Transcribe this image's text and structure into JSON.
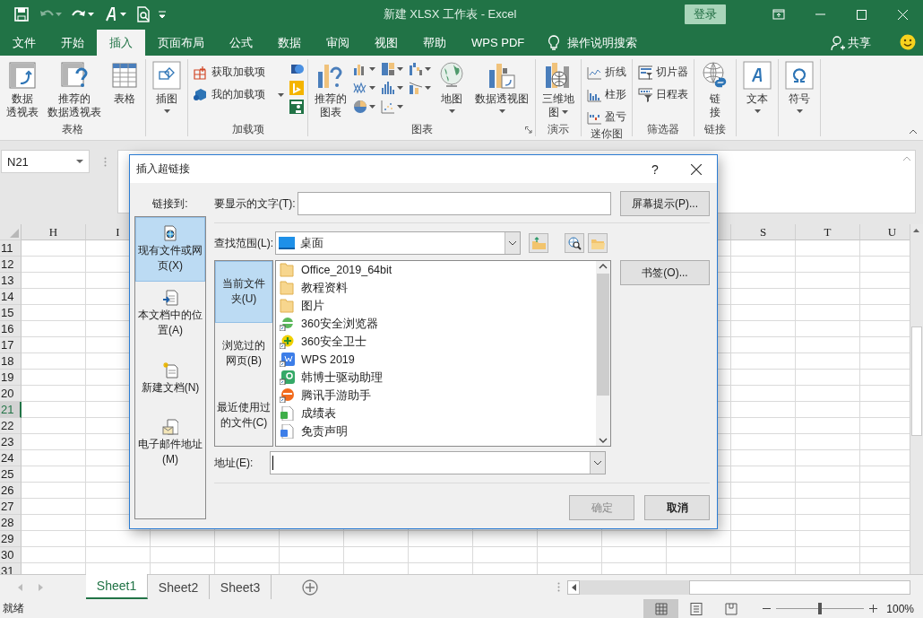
{
  "window": {
    "title": "新建 XLSX 工作表  -  Excel",
    "sign_in": "登录"
  },
  "quick_access": [
    {
      "disabled": false,
      "dropdown": false
    },
    {
      "disabled": true,
      "dropdown": true
    },
    {
      "disabled": false,
      "dropdown": true
    },
    {
      "disabled": false,
      "dropdown": true
    },
    {
      "disabled": false,
      "dropdown": false
    }
  ],
  "ribbon_tabs": [
    {
      "label": "文件",
      "selected": false
    },
    {
      "label": "开始",
      "selected": false
    },
    {
      "label": "插入",
      "selected": true
    },
    {
      "label": "页面布局",
      "selected": false
    },
    {
      "label": "公式",
      "selected": false
    },
    {
      "label": "数据",
      "selected": false
    },
    {
      "label": "审阅",
      "selected": false
    },
    {
      "label": "视图",
      "selected": false
    },
    {
      "label": "帮助",
      "selected": false
    },
    {
      "label": "WPS PDF",
      "selected": false
    }
  ],
  "tell_me": "操作说明搜索",
  "share": "共享",
  "ribbon_groups": [
    {
      "label": "表格",
      "launcher": false,
      "items": [
        {
          "kind": "large",
          "lines": [
            "数据",
            "透视表"
          ],
          "dropdown": false
        },
        {
          "kind": "large",
          "lines": [
            "推荐的",
            "数据透视表"
          ],
          "dropdown": false
        },
        {
          "kind": "large",
          "lines": [
            "表格"
          ],
          "dropdown": false
        }
      ]
    },
    {
      "launcher": false,
      "items": [
        {
          "kind": "large",
          "lines": [
            "插图"
          ],
          "dropdown": true
        }
      ]
    },
    {
      "label": "加载项",
      "launcher": false,
      "items": [
        {
          "kind": "stack",
          "entries": [
            {
              "label": "获取加载项",
              "dropdown": false
            },
            {
              "label": "我的加载项",
              "dropdown": true
            }
          ]
        },
        {
          "kind": "icon_stack",
          "icons": [
            {
              "dropdown": false
            },
            {
              "dropdown": false
            },
            {
              "dropdown": false
            }
          ]
        }
      ]
    },
    {
      "label": "图表",
      "launcher": true,
      "items": [
        {
          "kind": "large",
          "lines": [
            "推荐的",
            "图表"
          ],
          "dropdown": false
        },
        {
          "kind": "icon_grid",
          "icons": [
            {
              "dropdown": true
            },
            {
              "dropdown": true
            },
            {
              "dropdown": true
            },
            {
              "dropdown": true
            },
            {
              "dropdown": true
            },
            {
              "dropdown": true
            },
            {
              "dropdown": true
            },
            {
              "dropdown": true
            }
          ]
        },
        {
          "kind": "large",
          "lines": [
            "地图"
          ],
          "dropdown": true
        },
        {
          "kind": "large",
          "lines": [
            "数据透视图"
          ],
          "dropdown": true
        }
      ]
    },
    {
      "label": "演示",
      "launcher": false,
      "items": [
        {
          "kind": "large",
          "lines": [
            "三维地",
            "图"
          ],
          "dropdown": true
        }
      ]
    },
    {
      "label": "迷你图",
      "launcher": false,
      "items": [
        {
          "kind": "stack",
          "entries": [
            {
              "label": "折线",
              "dropdown": false
            },
            {
              "label": "柱形",
              "dropdown": false
            },
            {
              "label": "盈亏",
              "dropdown": false
            }
          ]
        }
      ]
    },
    {
      "label": "筛选器",
      "launcher": false,
      "items": [
        {
          "kind": "stack",
          "entries": [
            {
              "label": "切片器",
              "dropdown": false
            },
            {
              "label": "日程表",
              "dropdown": false
            }
          ]
        }
      ]
    },
    {
      "label": "链接",
      "launcher": false,
      "items": [
        {
          "kind": "large",
          "lines": [
            "链",
            "接"
          ],
          "dropdown": false
        }
      ]
    },
    {
      "launcher": false,
      "items": [
        {
          "kind": "large",
          "lines": [
            "文本"
          ],
          "dropdown": true
        }
      ]
    },
    {
      "launcher": false,
      "items": [
        {
          "kind": "large",
          "lines": [
            "符号"
          ],
          "dropdown": true
        }
      ]
    }
  ],
  "name_box": "N21",
  "columns_left": [
    "H",
    "I"
  ],
  "columns_right": [
    "S",
    "T",
    "U"
  ],
  "rows": [
    {
      "label": "11",
      "selected": false
    },
    {
      "label": "12",
      "selected": false
    },
    {
      "label": "13",
      "selected": false
    },
    {
      "label": "14",
      "selected": false
    },
    {
      "label": "15",
      "selected": false
    },
    {
      "label": "16",
      "selected": false
    },
    {
      "label": "17",
      "selected": false
    },
    {
      "label": "18",
      "selected": false
    },
    {
      "label": "19",
      "selected": false
    },
    {
      "label": "20",
      "selected": false
    },
    {
      "label": "21",
      "selected": true
    },
    {
      "label": "22",
      "selected": false
    },
    {
      "label": "23",
      "selected": false
    },
    {
      "label": "24",
      "selected": false
    },
    {
      "label": "25",
      "selected": false
    },
    {
      "label": "26",
      "selected": false
    },
    {
      "label": "27",
      "selected": false
    },
    {
      "label": "28",
      "selected": false
    },
    {
      "label": "29",
      "selected": false
    },
    {
      "label": "30",
      "selected": false
    },
    {
      "label": "31",
      "selected": false
    }
  ],
  "sheet_tabs": [
    {
      "label": "Sheet1",
      "selected": true
    },
    {
      "label": "Sheet2",
      "selected": false
    },
    {
      "label": "Sheet3",
      "selected": false
    }
  ],
  "status": "就绪",
  "views": [
    {
      "selected": true
    },
    {
      "selected": false
    },
    {
      "selected": false
    }
  ],
  "zoom": {
    "level": 0.5,
    "reading": "100%"
  },
  "dialog": {
    "title": "插入超链接",
    "help": "?",
    "link_to_label": "链接到:",
    "link_types": [
      {
        "label": "现有文件或网页(X)",
        "selected": true
      },
      {
        "label": "本文档中的位置(A)",
        "selected": false
      },
      {
        "label": "新建文档(N)",
        "selected": false
      },
      {
        "label": "电子邮件地址(M)",
        "selected": false
      }
    ],
    "display_text_label": "要显示的文字(T):",
    "screen_tip_button": "屏幕提示(P)...",
    "look_in_label": "查找范围(L):",
    "look_in_value": "桌面",
    "nav": [
      {
        "lines": [
          "当前文件",
          "夹(U)"
        ],
        "selected": true
      },
      {
        "lines": [
          "浏览过的",
          "网页(B)"
        ],
        "selected": false
      },
      {
        "lines": [
          "最近使用过",
          "的文件(C)"
        ],
        "selected": false
      }
    ],
    "files": [
      {
        "name": "Office_2019_64bit",
        "kind": "folder"
      },
      {
        "name": "教程资料",
        "kind": "folder"
      },
      {
        "name": "图片",
        "kind": "folder"
      },
      {
        "name": "360安全浏览器",
        "kind": "browser"
      },
      {
        "name": "360安全卫士",
        "kind": "guard"
      },
      {
        "name": "WPS 2019",
        "kind": "wps"
      },
      {
        "name": "韩博士驱动助理",
        "kind": "driver"
      },
      {
        "name": "腾讯手游助手",
        "kind": "game"
      },
      {
        "name": "成绩表",
        "kind": "sheet"
      },
      {
        "name": "免责声明",
        "kind": "doc"
      }
    ],
    "bookmark_button": "书签(O)...",
    "address_label": "地址(E):",
    "ok": {
      "label": "确定",
      "disabled": true
    },
    "cancel": {
      "label": "取消",
      "disabled": false
    }
  }
}
